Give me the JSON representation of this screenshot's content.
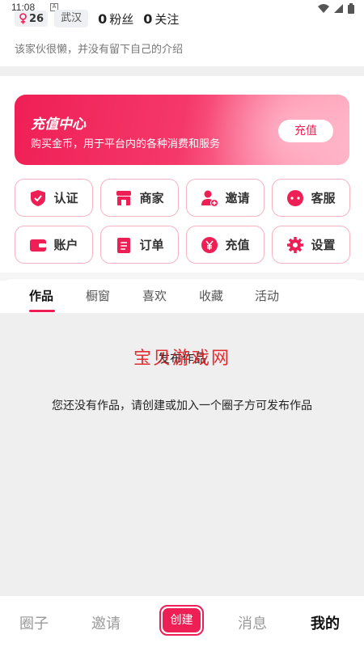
{
  "status_bar": {
    "time": "11:08",
    "notif_badge": "A"
  },
  "profile": {
    "age": "26",
    "city": "武汉",
    "fans_count": "0",
    "fans_label": "粉丝",
    "follow_count": "0",
    "follow_label": "关注",
    "bio": "该家伙很懒，并没有留下自己的介绍"
  },
  "banner": {
    "title": "充值中心",
    "subtitle": "购买金币，用于平台内的各种消费和服务",
    "button": "充值"
  },
  "grid": [
    {
      "label": "认证",
      "icon": "shield-check-icon"
    },
    {
      "label": "商家",
      "icon": "store-icon"
    },
    {
      "label": "邀请",
      "icon": "add-user-icon"
    },
    {
      "label": "客服",
      "icon": "chat-bubble-icon"
    },
    {
      "label": "账户",
      "icon": "wallet-icon"
    },
    {
      "label": "订单",
      "icon": "order-list-icon"
    },
    {
      "label": "充值",
      "icon": "yen-icon"
    },
    {
      "label": "设置",
      "icon": "gear-icon"
    }
  ],
  "tabs": [
    "作品",
    "橱窗",
    "喜欢",
    "收藏",
    "活动"
  ],
  "content": {
    "heading": "发布作品",
    "watermark": "宝贝游戏网",
    "message": "您还没有作品，请创建或加入一个圈子方可发布作品"
  },
  "bottom_nav": {
    "items": [
      "圈子",
      "邀请",
      "创建",
      "消息",
      "我的"
    ]
  },
  "colors": {
    "accent": "#ee1f55",
    "border": "#f6b3c2",
    "background": "#efefef"
  }
}
